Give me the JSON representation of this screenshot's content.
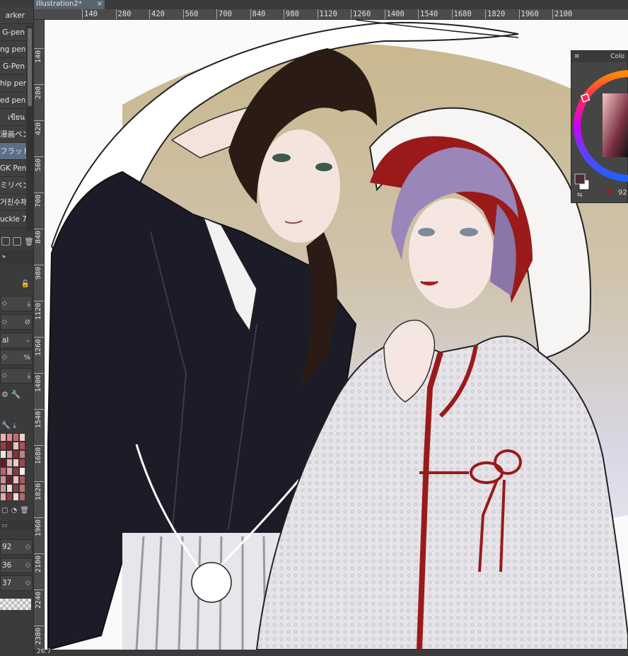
{
  "document": {
    "tab_title": "Illustration2*",
    "close_glyph": "×"
  },
  "brush_list": {
    "items": [
      {
        "label": "arker",
        "selected": false
      },
      {
        "label": "G-pen",
        "selected": false
      },
      {
        "label": "ng pen",
        "selected": false
      },
      {
        "label": "G-Pen",
        "selected": false
      },
      {
        "label": "hip pen",
        "selected": false
      },
      {
        "label": "ed pen",
        "selected": false
      },
      {
        "label": "เขียน",
        "selected": false
      },
      {
        "label": "漫画ペン",
        "selected": false
      },
      {
        "label": "フラット",
        "selected": true
      },
      {
        "label": "GK Pen",
        "selected": false
      },
      {
        "label": "ミリペン",
        "selected": false
      },
      {
        "label": "거친수채",
        "selected": false
      },
      {
        "label": "uckle 7",
        "selected": false
      }
    ]
  },
  "tool_property": {
    "blend_mode": "al",
    "brush_size": "92",
    "opacity": "36",
    "density": "37"
  },
  "rulers": {
    "top": [
      "140",
      "280",
      "420",
      "560",
      "700",
      "840",
      "980",
      "1120",
      "1260",
      "1400",
      "1540",
      "1680",
      "1820",
      "1960",
      "2100"
    ],
    "left": [
      "140",
      "280",
      "420",
      "560",
      "700",
      "840",
      "980",
      "1120",
      "1260",
      "1400",
      "1540",
      "1680",
      "1820",
      "1960",
      "2100",
      "2240",
      "2380"
    ]
  },
  "color_wheel": {
    "title": "Colo",
    "value": "92",
    "main_color": "#4a2a3a",
    "sub_color": "#ffffff"
  },
  "status": {
    "zoom": "26.7"
  },
  "palette_colors": [
    "#e8b4b8",
    "#d98a90",
    "#c46b73",
    "#f2d0d0",
    "#9c3a42",
    "#7a1f28",
    "#e6c2c2",
    "#b05058",
    "#f5e0e0",
    "#d0a0a8",
    "#8a3038",
    "#c08088",
    "#6a1820",
    "#e0b0b8",
    "#f0c8c8",
    "#a04850",
    "#b86870",
    "#d8a8b0",
    "#903840",
    "#f8e8e8",
    "#c89098",
    "#702028",
    "#e8c0c0",
    "#a85860",
    "#d09098",
    "#f0d8d8",
    "#804048",
    "#c07078",
    "#e0a8b0",
    "#983848",
    "#f4d4d8",
    "#b06870"
  ],
  "accent_colors": {
    "selection": "#5b6f86",
    "robe_dark": "#1c1c28",
    "hair_dark": "#2a1c14",
    "hair_purple": "#9a86b8",
    "hood_red": "#9a1a1a",
    "background": "#c8b89a"
  }
}
